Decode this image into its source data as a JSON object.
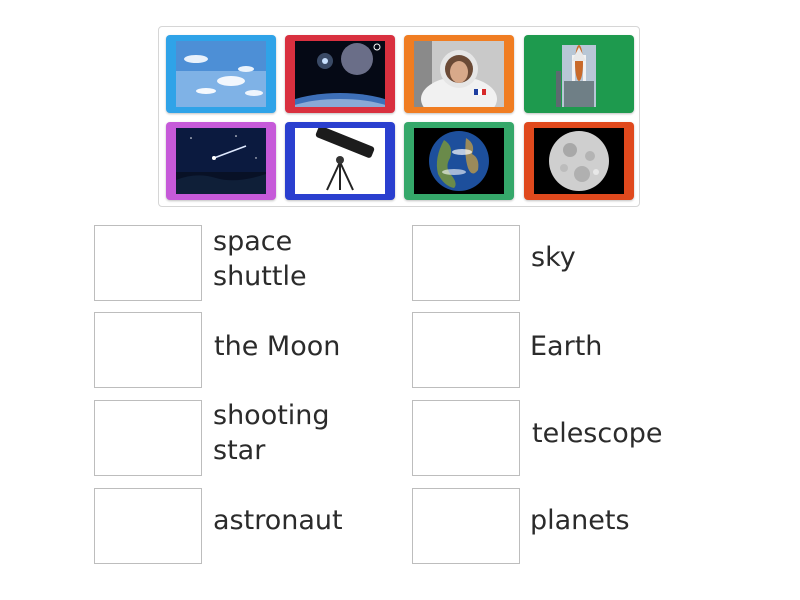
{
  "tiles": [
    {
      "name": "sky",
      "border": "#2fa3e8"
    },
    {
      "name": "planets",
      "border": "#d9303f"
    },
    {
      "name": "astronaut",
      "border": "#f07d22"
    },
    {
      "name": "space shuttle",
      "border": "#1e9a4e"
    },
    {
      "name": "shooting star",
      "border": "#c65ad9"
    },
    {
      "name": "telescope",
      "border": "#2a3fcf"
    },
    {
      "name": "Earth",
      "border": "#35a86a"
    },
    {
      "name": "the Moon",
      "border": "#e0491d"
    }
  ],
  "labels": {
    "space_shuttle": "space\nshuttle",
    "sky": "sky",
    "the_moon": "the Moon",
    "earth": "Earth",
    "shooting_star": "shooting\nstar",
    "telescope": "telescope",
    "astronaut": "astronaut",
    "planets": "planets"
  }
}
